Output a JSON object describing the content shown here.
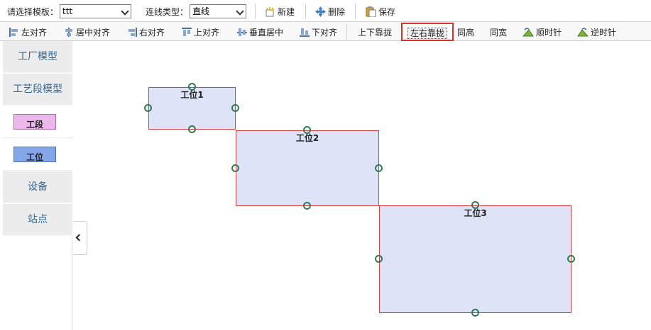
{
  "toolbar": {
    "template_label": "请选择模板：",
    "template_value": "ttt",
    "linktype_label": "连线类型：",
    "linktype_value": "直线",
    "new_label": "新建",
    "delete_label": "删除",
    "save_label": "保存"
  },
  "align_bar": {
    "left": "左对齐",
    "center": "居中对齐",
    "right": "右对齐",
    "top": "上对齐",
    "middle": "垂直居中",
    "bottom": "下对齐",
    "vclose": "上下靠拢",
    "hclose": "左右靠拢",
    "same_height": "同高",
    "same_width": "同宽",
    "clockwise": "顺时针",
    "counterclockwise": "逆时针"
  },
  "sidebar": {
    "factory_model": "工厂模型",
    "process_model": "工艺段模型",
    "section": "工段",
    "station": "工位",
    "device": "设备",
    "site": "站点"
  },
  "canvas": {
    "stations": [
      {
        "label": "工位1"
      },
      {
        "label": "工位2"
      },
      {
        "label": "工位3"
      }
    ]
  },
  "colors": {
    "section_fill": "#eab8ea",
    "station_palette_fill": "#86a6ea",
    "station_fill": "#dfe3f7",
    "station_border": "#d74141",
    "handle": "#2e7d52",
    "active_outline": "#d9342b",
    "sidebar_text": "#31689e"
  }
}
